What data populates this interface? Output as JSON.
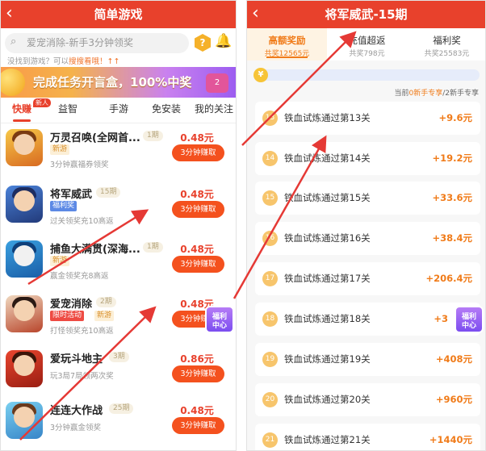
{
  "left": {
    "title": "简单游戏",
    "search_placeholder": "爱宠消除-新手3分钟领奖",
    "hint_prefix": "没找到游戏？可以",
    "hint_link": "搜搜看哦！",
    "hint_suffix": "↑↑",
    "help_label": "?",
    "banner_text": "完成任务开盲盒，100%中奖",
    "banner_gift": "2",
    "tabs": [
      {
        "label": "快赚",
        "badge": "新人"
      },
      {
        "label": "益智"
      },
      {
        "label": "手游"
      },
      {
        "label": "免安装"
      },
      {
        "label": "我的关注"
      }
    ],
    "games": [
      {
        "name": "万灵召唤(全网首...",
        "period": "1期",
        "tags": [
          {
            "text": "新游",
            "kind": "new"
          }
        ],
        "desc": "3分钟赢福券领奖",
        "price": "0.48元",
        "button": "3分钟赚取"
      },
      {
        "name": "将军威武",
        "period": "15期",
        "tags": [
          {
            "text": "福利奖",
            "kind": "fuli"
          }
        ],
        "desc": "过关领奖充10高返",
        "price": "0.48元",
        "button": "3分钟赚取"
      },
      {
        "name": "捕鱼大满贯(深海...",
        "period": "1期",
        "tags": [
          {
            "text": "新游",
            "kind": "new"
          }
        ],
        "desc": "赢金领奖充8高返",
        "price": "0.48元",
        "button": "3分钟赚取"
      },
      {
        "name": "爱宠消除",
        "period": "2期",
        "tags": [
          {
            "text": "限时活动",
            "kind": "limit"
          },
          {
            "text": "新游",
            "kind": "new"
          }
        ],
        "desc": "打怪领奖充10高返",
        "price": "0.48元",
        "button": "3分钟赚取"
      },
      {
        "name": "爱玩斗地主",
        "period": "3期",
        "tags": [],
        "desc": "玩3局7局领两次奖",
        "price": "0.86元",
        "button": "3分钟赚取"
      },
      {
        "name": "连连大作战",
        "period": "25期",
        "tags": [],
        "desc": "3分钟赢金领奖",
        "price": "0.48元",
        "button": "3分钟赚取"
      }
    ],
    "float_badge": [
      "福利",
      "中心"
    ]
  },
  "right": {
    "title": "将军威武-15期",
    "tabs": [
      {
        "title": "高额奖励",
        "sub": "共奖12565元"
      },
      {
        "title": "充值超返",
        "sub": "共奖798元"
      },
      {
        "title": "福利奖",
        "sub": "共奖25583元"
      }
    ],
    "progress_coin": "¥",
    "progress_fraction": 0.02,
    "current_prefix": "当前",
    "current_value": "0新手专享",
    "current_suffix": "/2新手专享",
    "tasks": [
      {
        "num": "13",
        "label": "铁血试炼通过第13关",
        "reward": "+9.6元"
      },
      {
        "num": "14",
        "label": "铁血试炼通过第14关",
        "reward": "+19.2元"
      },
      {
        "num": "15",
        "label": "铁血试炼通过第15关",
        "reward": "+33.6元"
      },
      {
        "num": "16",
        "label": "铁血试炼通过第16关",
        "reward": "+38.4元"
      },
      {
        "num": "17",
        "label": "铁血试炼通过第17关",
        "reward": "+206.4元"
      },
      {
        "num": "18",
        "label": "铁血试炼通过第18关",
        "reward": "+3"
      },
      {
        "num": "19",
        "label": "铁血试炼通过第19关",
        "reward": "+408元"
      },
      {
        "num": "20",
        "label": "铁血试炼通过第20关",
        "reward": "+960元"
      },
      {
        "num": "21",
        "label": "铁血试炼通过第21关",
        "reward": "+1440元"
      }
    ],
    "float_badge": [
      "福利",
      "中心"
    ]
  },
  "colors": {
    "header": "#e8412c",
    "accent": "#f07b19",
    "arrow": "#e53935"
  }
}
